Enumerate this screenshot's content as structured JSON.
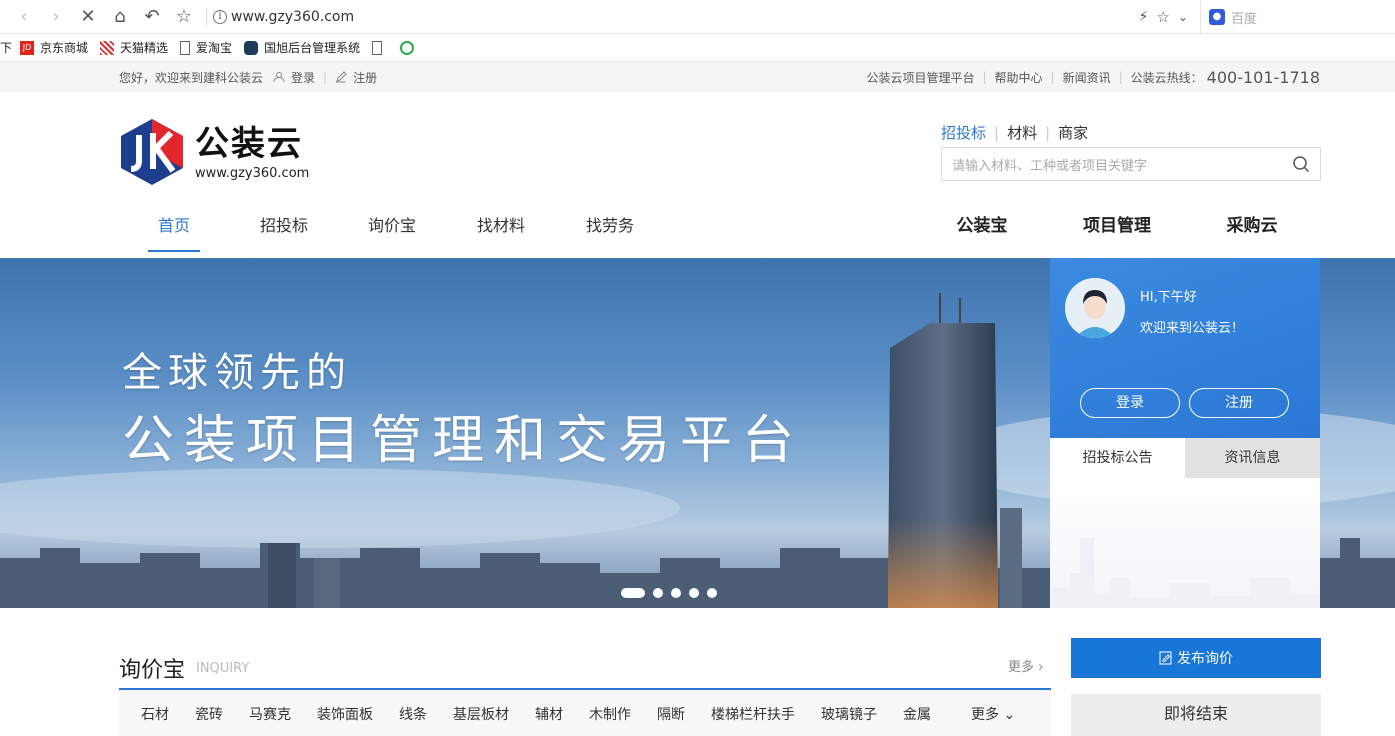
{
  "browser": {
    "url": "www.gzy360.com",
    "search_engine": "百度"
  },
  "bookmarks": [
    {
      "label": "下"
    },
    {
      "label": "京东商城"
    },
    {
      "label": "天猫精选"
    },
    {
      "label": "爱淘宝"
    },
    {
      "label": "国旭后台管理系统"
    }
  ],
  "topbar": {
    "greeting": "您好，欢迎来到建科公装云",
    "login": "登录",
    "register": "注册",
    "links": [
      "公装云项目管理平台",
      "帮助中心",
      "新闻资讯"
    ],
    "hotline_label": "公装云热线：",
    "hotline_number": "400-101-1718"
  },
  "header": {
    "logo_title": "公装云",
    "logo_url": "www.gzy360.com",
    "search_tabs": [
      "招投标",
      "材料",
      "商家"
    ],
    "search_placeholder": "请输入材料、工种或者项目关键字"
  },
  "nav": {
    "left": [
      "首页",
      "招投标",
      "询价宝",
      "找材料",
      "找劳务"
    ],
    "right": [
      "公装宝",
      "项目管理",
      "采购云"
    ]
  },
  "banner": {
    "line1": "全球领先的",
    "line2": "公装项目管理和交易平台",
    "slides": 5,
    "active_slide": 1
  },
  "user_panel": {
    "greeting": "HI,下午好",
    "welcome": "欢迎来到公装云！",
    "login": "登录",
    "register": "注册",
    "tabs": [
      "招投标公告",
      "资讯信息"
    ]
  },
  "inquiry": {
    "title": "询价宝",
    "subtitle": "INQUIRY",
    "more": "更多",
    "publish": "发布询价",
    "categories": [
      "石材",
      "瓷砖",
      "马赛克",
      "装饰面板",
      "线条",
      "基层板材",
      "辅材",
      "木制作",
      "隔断",
      "楼梯栏杆扶手",
      "玻璃镜子",
      "金属"
    ],
    "categories_more": "更多",
    "ending_soon": "即将结束"
  },
  "colors": {
    "accent": "#2a7ad2",
    "button_blue": "#1877d6",
    "logo_red": "#e3262b",
    "logo_navy": "#1d3e8c"
  }
}
